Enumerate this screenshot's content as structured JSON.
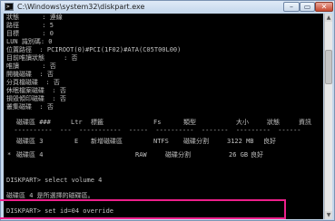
{
  "window": {
    "title": "C:\\Windows\\system32\\diskpart.exe",
    "icon": "console-app-icon",
    "controls": {
      "minimize": "–",
      "maximize": "▭",
      "close": "✕"
    }
  },
  "console": {
    "info_lines": [
      "狀態      : 連線",
      "路徑      : 5",
      "目標      : 0",
      "LUN 識別碼: 0",
      "位置路徑  : PCIROOT(0)#PCI(1F02)#ATA(C05T00L00)",
      "目前唯讀狀態     : 否",
      "唯讀      : 否",
      "開機磁碟  : 否",
      "分頁檔磁碟  : 否",
      "休眠檔案磁碟  : 否",
      "損毀傾印磁碟  : 否",
      "叢集磁碟  : 否"
    ],
    "volume_table": {
      "headers": [
        "磁碟區 ###",
        "Ltr",
        "標籤",
        "Fs",
        "類型",
        "大小",
        "狀態",
        "資訊"
      ],
      "rows": [
        {
          "marker": "",
          "volume": "磁碟區 3",
          "ltr": "E",
          "label": "新增磁碟區",
          "fs": "NTFS",
          "type": "磁碟分割",
          "size": "3122 MB",
          "status": "良好",
          "info": ""
        },
        {
          "marker": "*",
          "volume": "磁碟區 4",
          "ltr": "",
          "label": "",
          "fs": "RAW",
          "type": "磁碟分割",
          "size": "26 GB",
          "status": "良好",
          "info": ""
        }
      ]
    },
    "command_1": "DISKPART> select volume 4",
    "response_1": "磁碟區 4 是所選擇的磁碟區。",
    "command_2": "DISKPART> set id=04 override"
  },
  "colors": {
    "console_bg": "#000000",
    "console_text": "#c0c0c0",
    "highlight": "#ee1f8a",
    "window_frame": "#c4d7ec"
  }
}
